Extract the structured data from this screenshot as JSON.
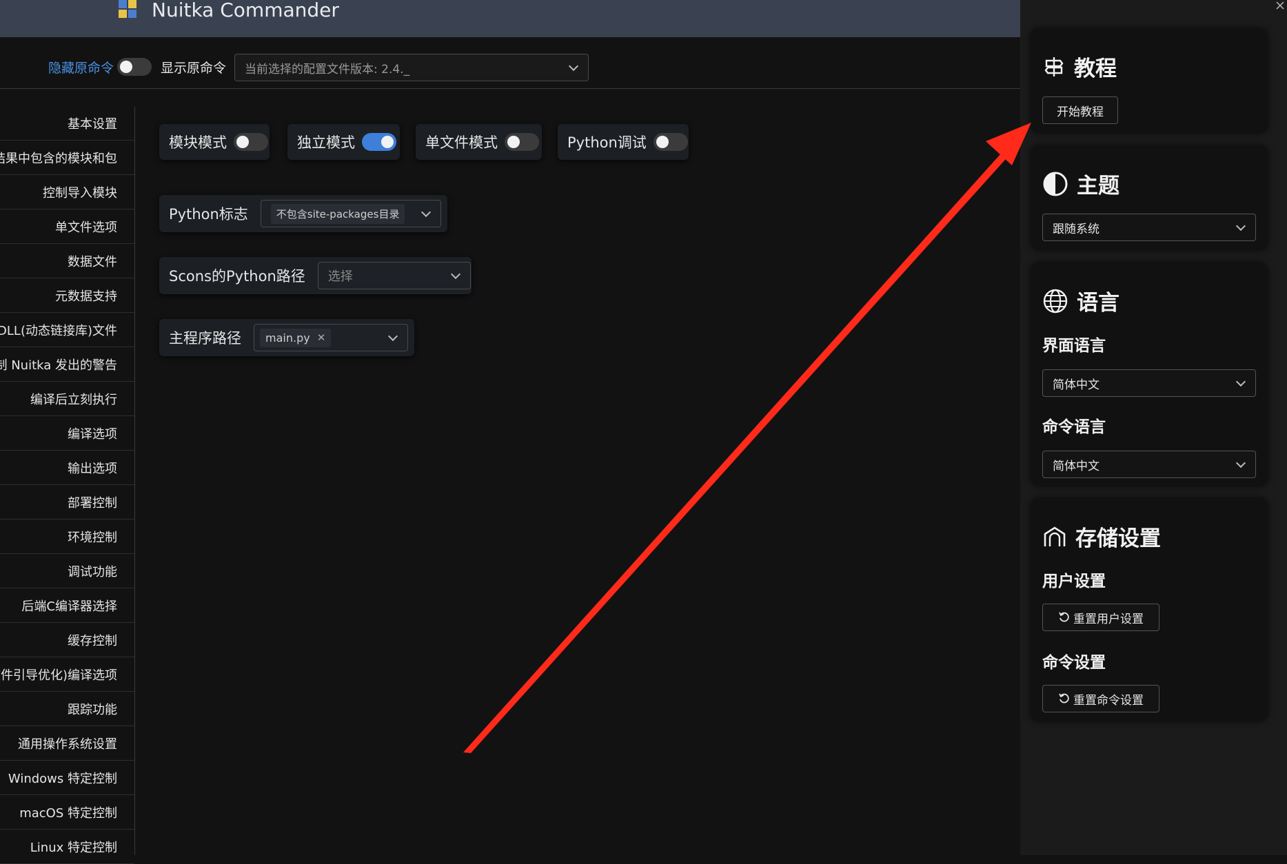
{
  "app": {
    "title": "Nuitka Commander"
  },
  "toolbar": {
    "hide_label": "隐藏原命令",
    "show_label": "显示原命令",
    "config_select": "当前选择的配置文件版本: 2.4._"
  },
  "sidebar": {
    "items": [
      "基本设置",
      "结果中包含的模块和包",
      "控制导入模块",
      "单文件选项",
      "数据文件",
      "元数据支持",
      "DLL(动态链接库)文件",
      "控制 Nuitka 发出的警告",
      "编译后立刻执行",
      "编译选项",
      "输出选项",
      "部署控制",
      "环境控制",
      "调试功能",
      "后端C编译器选择",
      "缓存控制",
      "PGO(配置文件引导优化)编译选项",
      "跟踪功能",
      "通用操作系统设置",
      "Windows 特定控制",
      "macOS 特定控制",
      "Linux 特定控制"
    ]
  },
  "main": {
    "modes": [
      {
        "label": "模块模式",
        "on": false
      },
      {
        "label": "独立模式",
        "on": true
      },
      {
        "label": "单文件模式",
        "on": false
      },
      {
        "label": "Python调试",
        "on": false
      }
    ],
    "python_flag": {
      "label": "Python标志",
      "value": "不包含site-packages目录"
    },
    "scons": {
      "label": "Scons的Python路径",
      "placeholder": "选择"
    },
    "main_path": {
      "label": "主程序路径",
      "value": "main.py"
    }
  },
  "right_panel": {
    "tutorial": {
      "title": "教程",
      "button": "开始教程"
    },
    "theme": {
      "title": "主题",
      "value": "跟随系统"
    },
    "language": {
      "title": "语言",
      "ui_label": "界面语言",
      "ui_value": "简体中文",
      "cmd_label": "命令语言",
      "cmd_value": "简体中文"
    },
    "storage": {
      "title": "存储设置",
      "user_label": "用户设置",
      "user_button": "重置用户设置",
      "cmd_label": "命令设置",
      "cmd_button": "重置命令设置"
    }
  },
  "colors": {
    "accent": "#3d7fd9",
    "link": "#4a90e2",
    "annotation_arrow": "#ff2a1a"
  }
}
